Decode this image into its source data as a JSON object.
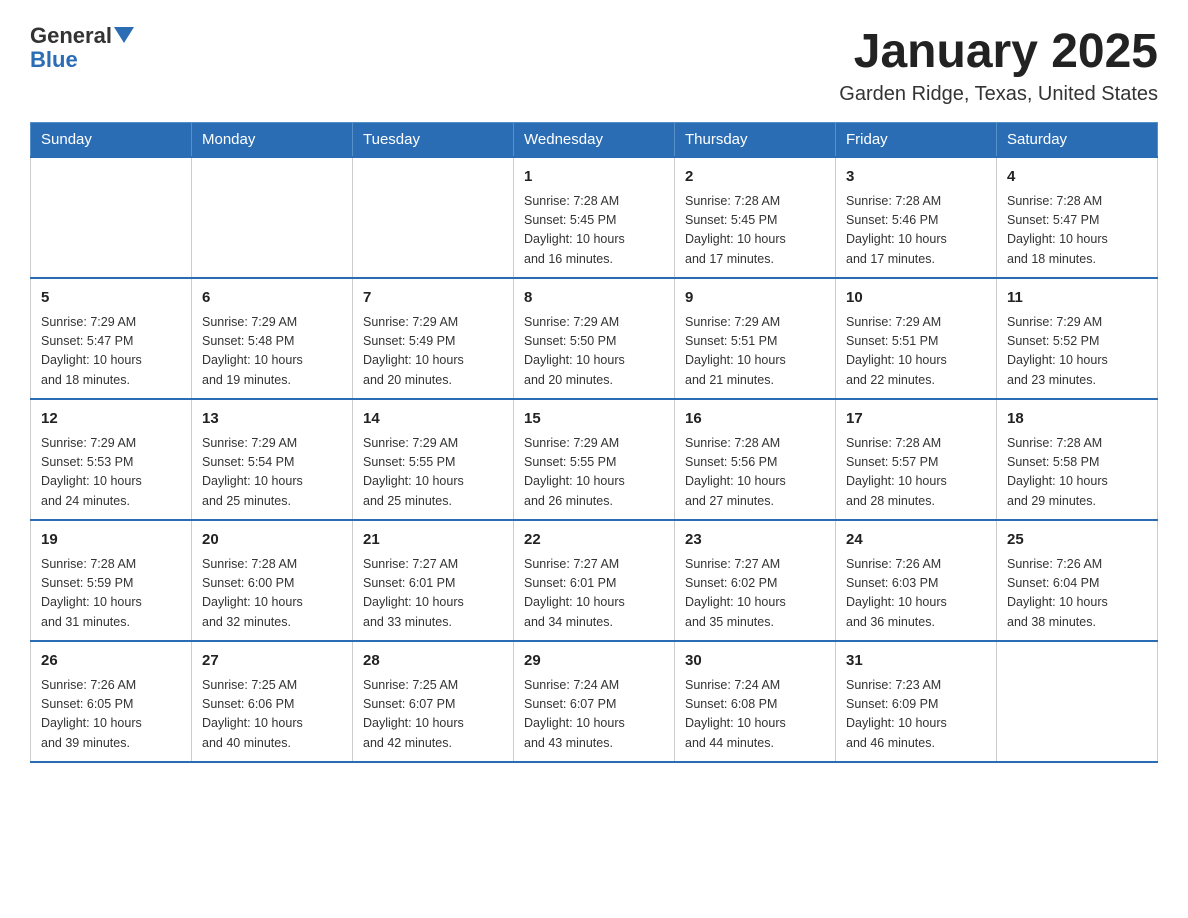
{
  "header": {
    "logo_general": "General",
    "logo_blue": "Blue",
    "month_year": "January 2025",
    "location": "Garden Ridge, Texas, United States"
  },
  "days_of_week": [
    "Sunday",
    "Monday",
    "Tuesday",
    "Wednesday",
    "Thursday",
    "Friday",
    "Saturday"
  ],
  "weeks": [
    [
      {
        "day": "",
        "info": ""
      },
      {
        "day": "",
        "info": ""
      },
      {
        "day": "",
        "info": ""
      },
      {
        "day": "1",
        "info": "Sunrise: 7:28 AM\nSunset: 5:45 PM\nDaylight: 10 hours\nand 16 minutes."
      },
      {
        "day": "2",
        "info": "Sunrise: 7:28 AM\nSunset: 5:45 PM\nDaylight: 10 hours\nand 17 minutes."
      },
      {
        "day": "3",
        "info": "Sunrise: 7:28 AM\nSunset: 5:46 PM\nDaylight: 10 hours\nand 17 minutes."
      },
      {
        "day": "4",
        "info": "Sunrise: 7:28 AM\nSunset: 5:47 PM\nDaylight: 10 hours\nand 18 minutes."
      }
    ],
    [
      {
        "day": "5",
        "info": "Sunrise: 7:29 AM\nSunset: 5:47 PM\nDaylight: 10 hours\nand 18 minutes."
      },
      {
        "day": "6",
        "info": "Sunrise: 7:29 AM\nSunset: 5:48 PM\nDaylight: 10 hours\nand 19 minutes."
      },
      {
        "day": "7",
        "info": "Sunrise: 7:29 AM\nSunset: 5:49 PM\nDaylight: 10 hours\nand 20 minutes."
      },
      {
        "day": "8",
        "info": "Sunrise: 7:29 AM\nSunset: 5:50 PM\nDaylight: 10 hours\nand 20 minutes."
      },
      {
        "day": "9",
        "info": "Sunrise: 7:29 AM\nSunset: 5:51 PM\nDaylight: 10 hours\nand 21 minutes."
      },
      {
        "day": "10",
        "info": "Sunrise: 7:29 AM\nSunset: 5:51 PM\nDaylight: 10 hours\nand 22 minutes."
      },
      {
        "day": "11",
        "info": "Sunrise: 7:29 AM\nSunset: 5:52 PM\nDaylight: 10 hours\nand 23 minutes."
      }
    ],
    [
      {
        "day": "12",
        "info": "Sunrise: 7:29 AM\nSunset: 5:53 PM\nDaylight: 10 hours\nand 24 minutes."
      },
      {
        "day": "13",
        "info": "Sunrise: 7:29 AM\nSunset: 5:54 PM\nDaylight: 10 hours\nand 25 minutes."
      },
      {
        "day": "14",
        "info": "Sunrise: 7:29 AM\nSunset: 5:55 PM\nDaylight: 10 hours\nand 25 minutes."
      },
      {
        "day": "15",
        "info": "Sunrise: 7:29 AM\nSunset: 5:55 PM\nDaylight: 10 hours\nand 26 minutes."
      },
      {
        "day": "16",
        "info": "Sunrise: 7:28 AM\nSunset: 5:56 PM\nDaylight: 10 hours\nand 27 minutes."
      },
      {
        "day": "17",
        "info": "Sunrise: 7:28 AM\nSunset: 5:57 PM\nDaylight: 10 hours\nand 28 minutes."
      },
      {
        "day": "18",
        "info": "Sunrise: 7:28 AM\nSunset: 5:58 PM\nDaylight: 10 hours\nand 29 minutes."
      }
    ],
    [
      {
        "day": "19",
        "info": "Sunrise: 7:28 AM\nSunset: 5:59 PM\nDaylight: 10 hours\nand 31 minutes."
      },
      {
        "day": "20",
        "info": "Sunrise: 7:28 AM\nSunset: 6:00 PM\nDaylight: 10 hours\nand 32 minutes."
      },
      {
        "day": "21",
        "info": "Sunrise: 7:27 AM\nSunset: 6:01 PM\nDaylight: 10 hours\nand 33 minutes."
      },
      {
        "day": "22",
        "info": "Sunrise: 7:27 AM\nSunset: 6:01 PM\nDaylight: 10 hours\nand 34 minutes."
      },
      {
        "day": "23",
        "info": "Sunrise: 7:27 AM\nSunset: 6:02 PM\nDaylight: 10 hours\nand 35 minutes."
      },
      {
        "day": "24",
        "info": "Sunrise: 7:26 AM\nSunset: 6:03 PM\nDaylight: 10 hours\nand 36 minutes."
      },
      {
        "day": "25",
        "info": "Sunrise: 7:26 AM\nSunset: 6:04 PM\nDaylight: 10 hours\nand 38 minutes."
      }
    ],
    [
      {
        "day": "26",
        "info": "Sunrise: 7:26 AM\nSunset: 6:05 PM\nDaylight: 10 hours\nand 39 minutes."
      },
      {
        "day": "27",
        "info": "Sunrise: 7:25 AM\nSunset: 6:06 PM\nDaylight: 10 hours\nand 40 minutes."
      },
      {
        "day": "28",
        "info": "Sunrise: 7:25 AM\nSunset: 6:07 PM\nDaylight: 10 hours\nand 42 minutes."
      },
      {
        "day": "29",
        "info": "Sunrise: 7:24 AM\nSunset: 6:07 PM\nDaylight: 10 hours\nand 43 minutes."
      },
      {
        "day": "30",
        "info": "Sunrise: 7:24 AM\nSunset: 6:08 PM\nDaylight: 10 hours\nand 44 minutes."
      },
      {
        "day": "31",
        "info": "Sunrise: 7:23 AM\nSunset: 6:09 PM\nDaylight: 10 hours\nand 46 minutes."
      },
      {
        "day": "",
        "info": ""
      }
    ]
  ]
}
